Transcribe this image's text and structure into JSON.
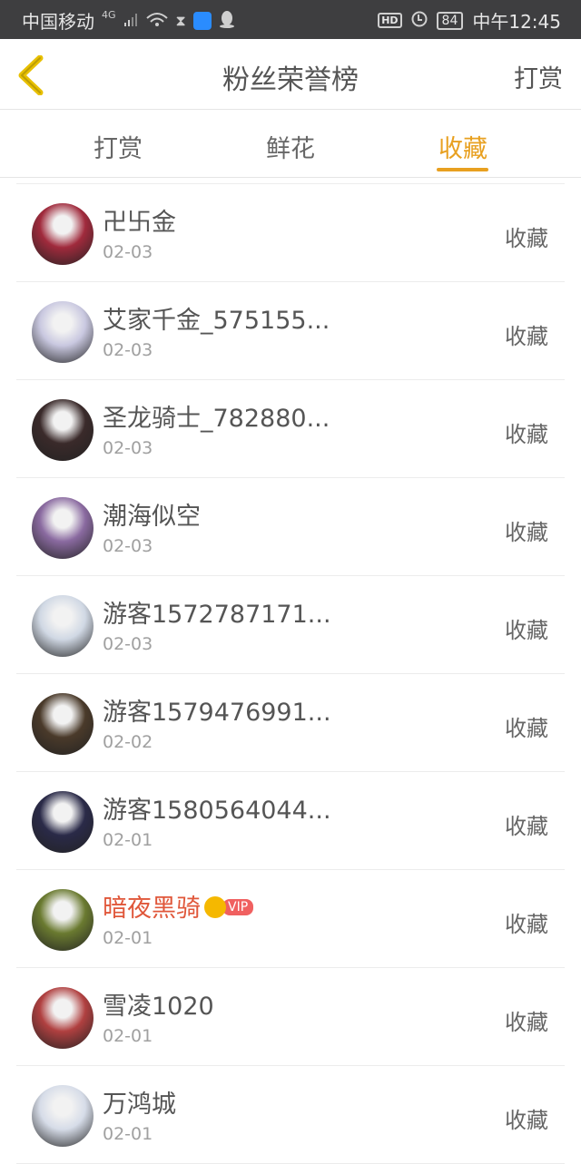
{
  "status_bar": {
    "carrier": "中国移动",
    "network": "4G",
    "battery": "84",
    "time": "中午12:45"
  },
  "header": {
    "title": "粉丝荣誉榜",
    "right_action": "打赏"
  },
  "tabs": [
    {
      "label": "打赏",
      "active": false
    },
    {
      "label": "鲜花",
      "active": false
    },
    {
      "label": "收藏",
      "active": true
    }
  ],
  "colors": {
    "accent": "#e8a020",
    "vip_name": "#e0573a"
  },
  "fans": [
    {
      "name": "卍卐金",
      "date": "02-03",
      "action": "收藏",
      "vip": false,
      "avatar_color": "#a02a3c"
    },
    {
      "name": "艾家千金_575155...",
      "date": "02-03",
      "action": "收藏",
      "vip": false,
      "avatar_color": "#c9c8e0"
    },
    {
      "name": "圣龙骑士_782880...",
      "date": "02-03",
      "action": "收藏",
      "vip": false,
      "avatar_color": "#3a2a2a"
    },
    {
      "name": "潮海似空",
      "date": "02-03",
      "action": "收藏",
      "vip": false,
      "avatar_color": "#8a6aa0"
    },
    {
      "name": "游客1572787171...",
      "date": "02-03",
      "action": "收藏",
      "vip": false,
      "avatar_color": "#d0d8e4"
    },
    {
      "name": "游客1579476991...",
      "date": "02-02",
      "action": "收藏",
      "vip": false,
      "avatar_color": "#4a3a2a"
    },
    {
      "name": "游客1580564044...",
      "date": "02-01",
      "action": "收藏",
      "vip": false,
      "avatar_color": "#2a2a48"
    },
    {
      "name": "暗夜黑骑",
      "date": "02-01",
      "action": "收藏",
      "vip": true,
      "vip_label": "VIP",
      "avatar_color": "#6a7a30"
    },
    {
      "name": "雪凌1020",
      "date": "02-01",
      "action": "收藏",
      "vip": false,
      "avatar_color": "#b04040"
    },
    {
      "name": "万鸿城",
      "date": "02-01",
      "action": "收藏",
      "vip": false,
      "avatar_color": "#d6dce8"
    }
  ]
}
